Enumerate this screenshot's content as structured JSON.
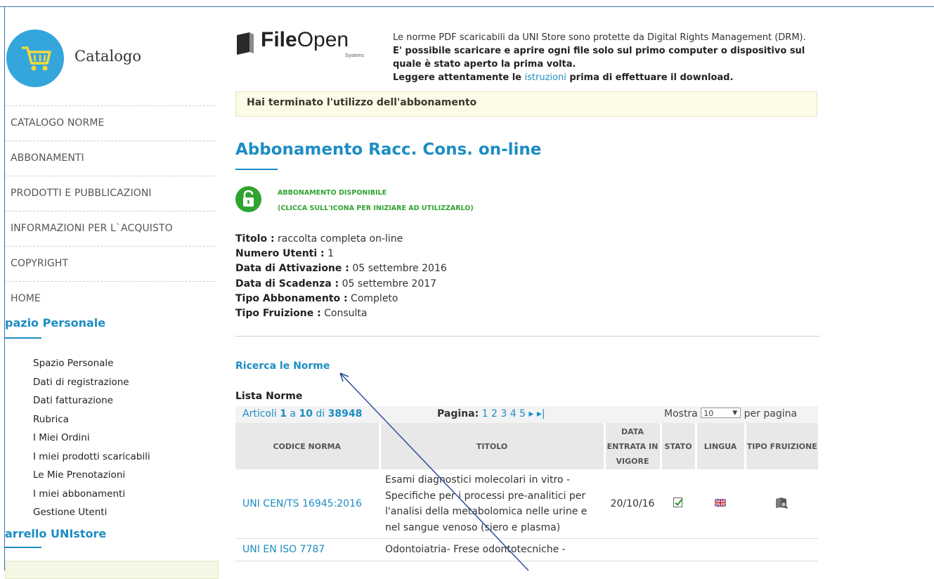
{
  "sidebar": {
    "brand_title": "Catalogo",
    "menu": [
      {
        "label": "CATALOGO NORME"
      },
      {
        "label": "ABBONAMENTI"
      },
      {
        "label": "PRODOTTI E PUBBLICAZIONI"
      },
      {
        "label": "INFORMAZIONI PER L`ACQUISTO"
      },
      {
        "label": "COPYRIGHT"
      },
      {
        "label": "HOME"
      }
    ],
    "personal_title": "pazio Personale",
    "personal_items": [
      {
        "label": "Spazio Personale"
      },
      {
        "label": "Dati di registrazione"
      },
      {
        "label": "Dati fatturazione"
      },
      {
        "label": "Rubrica"
      },
      {
        "label": "I Miei Ordini"
      },
      {
        "label": "I miei prodotti scaricabili"
      },
      {
        "label": "Le Mie Prenotazioni"
      },
      {
        "label": "I miei abbonamenti"
      },
      {
        "label": "Gestione Utenti"
      }
    ],
    "cart_title": "arrello UNIstore"
  },
  "fileopen": {
    "brand_bold": "File",
    "brand_light": "Open",
    "brand_sub": "Systems",
    "line1": "Le norme PDF scaricabili da UNI Store sono protette da Digital Rights Management (DRM).",
    "line2": "E' possibile scaricare e aprire ogni file solo sul primo computer o dispositivo sul quale è stato aperto la prima volta.",
    "line3_pre": "Leggere attentamente le ",
    "line3_link": "istruzioni",
    "line3_post": " prima di effettuare il download."
  },
  "notice": "Hai terminato l'utilizzo dell'abbonamento",
  "page_title": "Abbonamento Racc. Cons. on-line",
  "status": {
    "line1": "ABBONAMENTO DISPONIBILE",
    "line2": "(CLICCA SULL'ICONA PER INIZIARE AD UTILIZZARLO)"
  },
  "info": [
    {
      "label": "Titolo :",
      "value": " raccolta completa on-line"
    },
    {
      "label": "Numero Utenti :",
      "value": " 1"
    },
    {
      "label": "Data di Attivazione :",
      "value": " 05 settembre 2016"
    },
    {
      "label": "Data di Scadenza :",
      "value": " 05 settembre 2017"
    },
    {
      "label": "Tipo Abbonamento :",
      "value": " Completo"
    },
    {
      "label": "Tipo Fruizione :",
      "value": " Consulta"
    }
  ],
  "search_link": "Ricerca le Norme",
  "list_title": "Lista Norme",
  "pager": {
    "articoli": "Articoli",
    "from": "1",
    "a": "a",
    "to": "10",
    "di": "di",
    "total": "38948",
    "pagina_label": "Pagina:",
    "pages": "1 2 3 4 5 ▸ ▸|",
    "mostra": "Mostra",
    "per_page_value": "10",
    "per_pagina": "per pagina"
  },
  "table": {
    "headers": [
      "CODICE NORMA",
      "TITOLO",
      "DATA ENTRATA IN VIGORE",
      "STATO",
      "LINGUA",
      "TIPO FRUIZIONE"
    ],
    "rows": [
      {
        "code": "UNI CEN/TS 16945:2016",
        "title": "Esami diagnostici molecolari in vitro - Specifiche per i processi pre-analitici per l'analisi della metabolomica nelle urine e nel sangue venoso (siero e plasma)",
        "date": "20/10/16"
      },
      {
        "code": "UNI EN ISO 7787",
        "title": "Odontoiatria- Frese odontotecniche -",
        "date": ""
      }
    ]
  },
  "colors": {
    "accent": "#1c8dc3",
    "green": "#30a431",
    "frame": "#3a6fb3"
  }
}
